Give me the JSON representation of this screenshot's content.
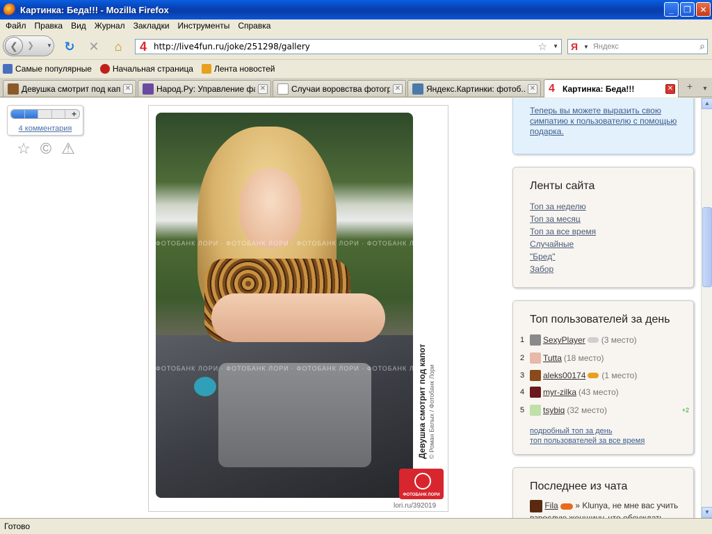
{
  "window": {
    "title": "Картинка: Беда!!! - Mozilla Firefox",
    "minimize": "_",
    "maximize": "❐",
    "close": "✕"
  },
  "menu": [
    "Файл",
    "Правка",
    "Вид",
    "Журнал",
    "Закладки",
    "Инструменты",
    "Справка"
  ],
  "toolbar": {
    "url": "http://live4fun.ru/joke/251298/gallery",
    "site_icon": "4",
    "search_placeholder": "Яндекс",
    "search_engine_icon": "Я"
  },
  "bookmarks": [
    {
      "label": "Самые популярные",
      "icon": "search-page-icon",
      "color": "#4a6fbf"
    },
    {
      "label": "Начальная страница",
      "icon": "red-hat-icon",
      "color": "#c0201a"
    },
    {
      "label": "Лента новостей",
      "icon": "rss-icon",
      "color": "#e8a020"
    }
  ],
  "tabs": [
    {
      "label": "Девушка смотрит под кап...",
      "color": "#8a5a2a",
      "active": false
    },
    {
      "label": "Народ.Ру: Управление фа...",
      "color": "#6a4aa0",
      "active": false
    },
    {
      "label": "Случаи воровства фотогр...",
      "color": "#ffffff",
      "active": false
    },
    {
      "label": "Яндекс.Картинки: фотоб...",
      "color": "#4a7aa8",
      "active": false
    },
    {
      "label": "Картинка: Беда!!!",
      "color": "#e0262b",
      "active": true
    }
  ],
  "rating": {
    "filled": 2,
    "total": 5,
    "plus": "+",
    "comments": "4 комментария"
  },
  "actions": {
    "favorite": "☆",
    "copyright": "©",
    "report": "⚠"
  },
  "photo": {
    "watermark": "ФОТОБАНК ЛОРИ · ФОТОБАНК ЛОРИ · ФОТОБАНК ЛОРИ · ФОТОБАНК ЛОРИ · ФОТОБАНК ЛОРИ",
    "caption": "Девушка смотрит под капот",
    "credit": "© Роман Белых / Фотобанк Лори",
    "badge": "ФОТОБАНК ЛОРИ",
    "id": "lori.ru/392019"
  },
  "promo": {
    "text": "Теперь вы можете выразить свою симпатию к пользователю с помощью подарка."
  },
  "feeds": {
    "title": "Ленты сайта",
    "items": [
      "Топ за неделю",
      "Топ за месяц",
      "Топ за все время",
      "Случайные",
      "\"Бред\"",
      "Забор"
    ]
  },
  "top_users": {
    "title": "Топ пользователей за день",
    "users": [
      {
        "rank": "1",
        "name": "SexyPlayer",
        "place": "(3 место)",
        "avatar": "#8a8a8a",
        "gift": "#cfcfcf"
      },
      {
        "rank": "2",
        "name": "Tutta",
        "place": "(18 место)",
        "avatar": "#e8b8a8",
        "gift": ""
      },
      {
        "rank": "3",
        "name": "aleks00174",
        "place": "(1 место)",
        "avatar": "#8a4a1a",
        "gift": "#e8a020"
      },
      {
        "rank": "4",
        "name": "myr-zilka",
        "place": "(43 место)",
        "avatar": "#6a1a1a",
        "gift": ""
      },
      {
        "rank": "5",
        "name": "tsybiq",
        "place": "(32 место)",
        "avatar": "#bfe0a8",
        "gift": ""
      }
    ],
    "plus": "+2",
    "links": [
      "подробный топ за день",
      "топ пользователей за все время"
    ]
  },
  "chat": {
    "title": "Последнее из чата",
    "name": "Fila",
    "message": "» Klunya, не мне вас учить взрослую женщину, что обсуждать"
  },
  "status": "Готово"
}
